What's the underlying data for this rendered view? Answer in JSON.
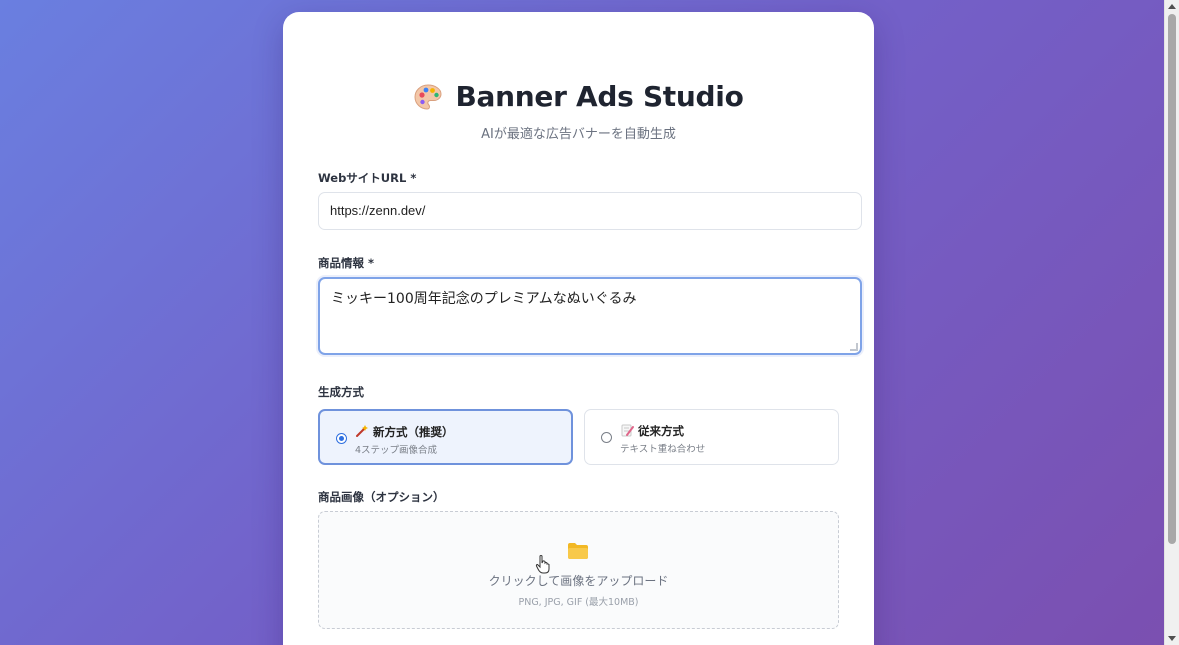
{
  "header": {
    "title": "Banner Ads Studio",
    "subtitle": "AIが最適な広告バナーを自動生成",
    "icon": "palette-icon"
  },
  "form": {
    "url": {
      "label": "WebサイトURL *",
      "value": "https://zenn.dev/"
    },
    "product": {
      "label": "商品情報 *",
      "value": "ミッキー100周年記念のプレミアムなぬいぐるみ"
    },
    "method": {
      "label": "生成方式",
      "options": [
        {
          "title": "新方式（推奨）",
          "subtitle": "4ステップ画像合成",
          "icon": "wand-icon",
          "selected": true
        },
        {
          "title": "従来方式",
          "subtitle": "テキスト重ね合わせ",
          "icon": "memo-icon",
          "selected": false
        }
      ]
    },
    "image": {
      "label": "商品画像（オプション）",
      "upload_text": "クリックして画像をアップロード",
      "hint": "PNG, JPG, GIF (最大10MB)",
      "icon": "folder-icon"
    }
  },
  "colors": {
    "accent": "#2f6fe0",
    "bg_start": "#6a7fe0",
    "bg_end": "#7b4fb0"
  }
}
